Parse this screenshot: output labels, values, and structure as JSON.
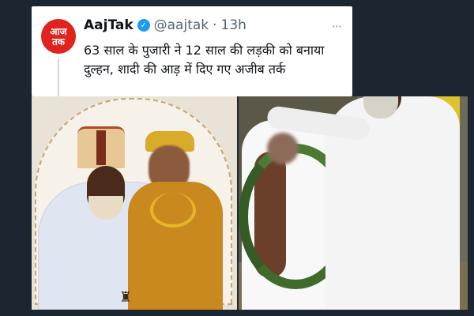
{
  "tweet": {
    "avatar": {
      "line1": "आज",
      "line2": "तक"
    },
    "name": "AajTak",
    "handle": "@aajtak",
    "separator": "·",
    "time": "13h",
    "more_label": "···",
    "text": "63 साल के पुजारी ने 12 साल की लड़की को बनाया दुल्हन, शादी की आड़ में दिए गए अजीब तर्क"
  },
  "colors": {
    "background": "#15202b",
    "brand_red": "#e0231c",
    "verified_blue": "#1d9bf0",
    "text_primary": "#0f1419",
    "text_secondary": "#536471"
  },
  "icons": {
    "verified": "verified-badge-icon",
    "more": "more-options-icon"
  }
}
